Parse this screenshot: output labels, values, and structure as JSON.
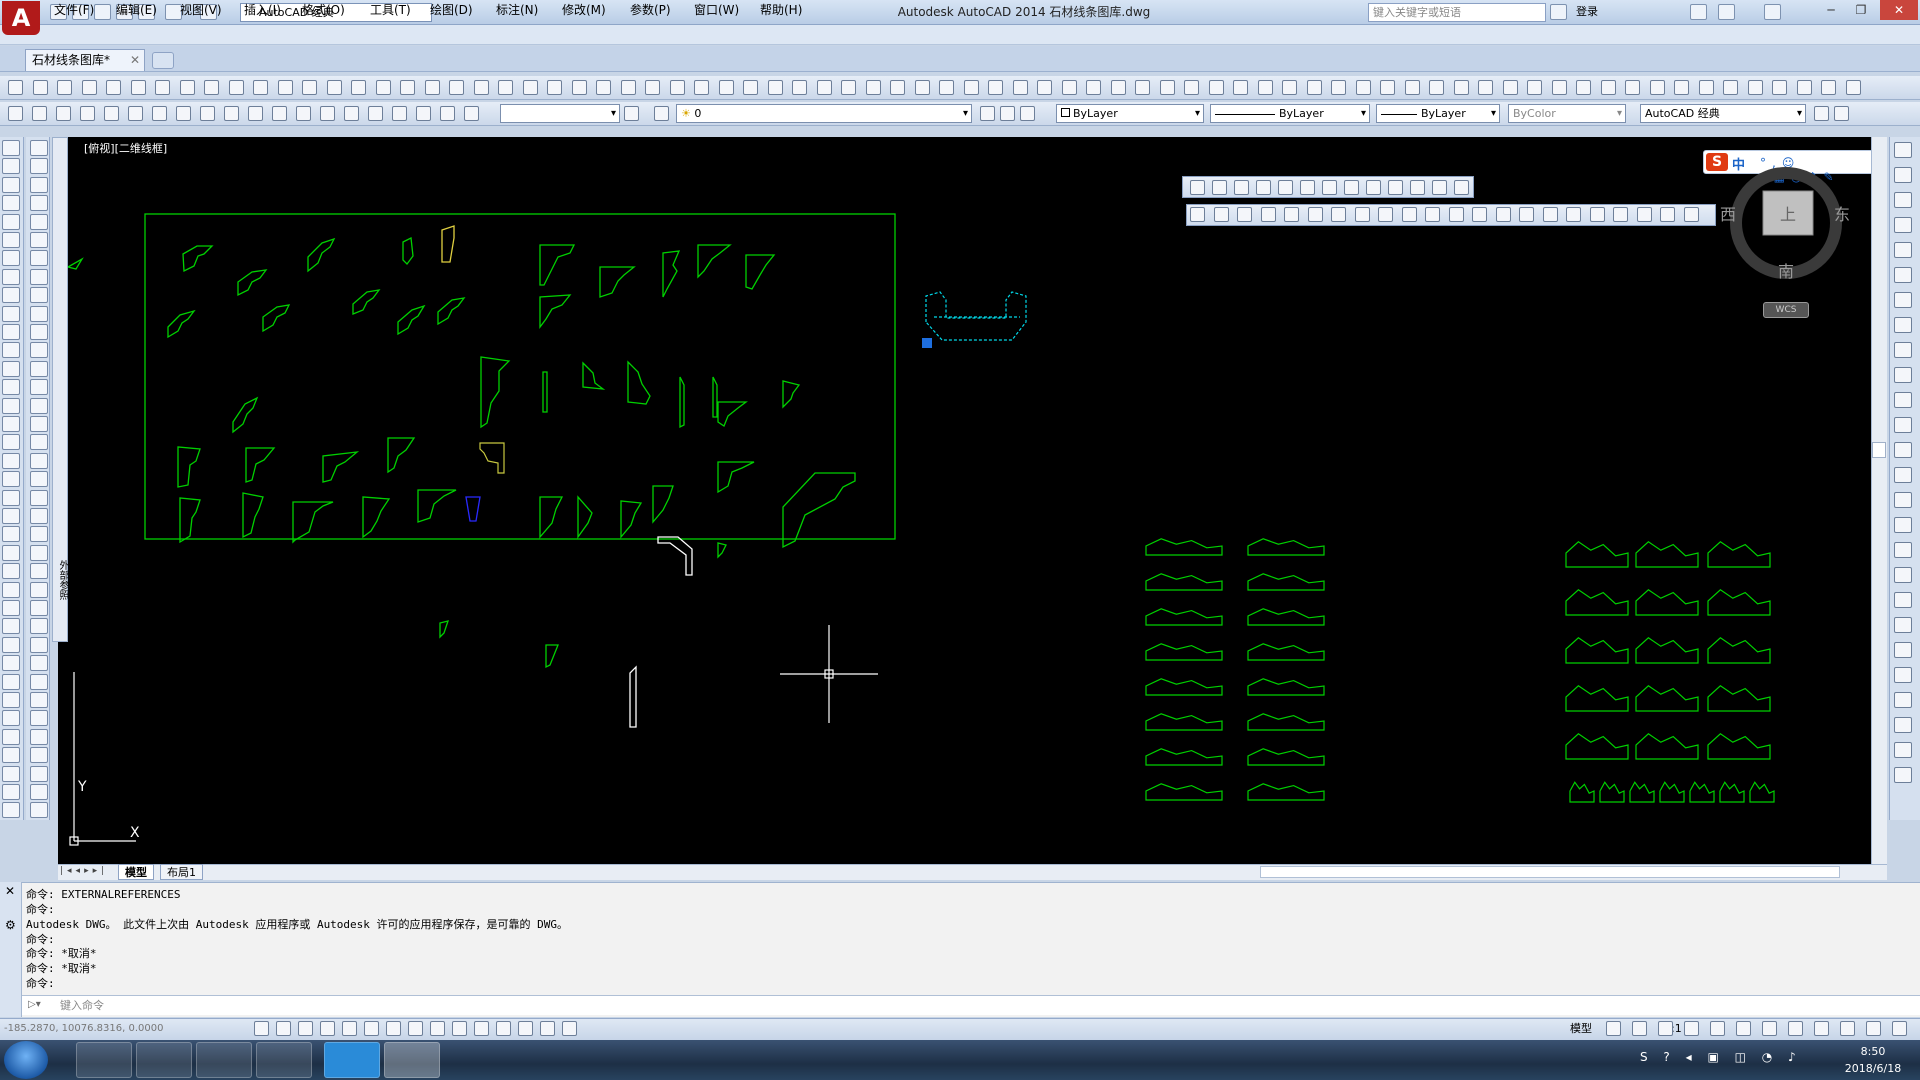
{
  "titlebar": {
    "workspace": "AutoCAD 经典",
    "title": "Autodesk AutoCAD 2014    石材线条图库.dwg",
    "search_placeholder": "键入关键字或短语",
    "login": "登录"
  },
  "menu": [
    "文件(F)",
    "编辑(E)",
    "视图(V)",
    "插入(I)",
    "格式(O)",
    "工具(T)",
    "绘图(D)",
    "标注(N)",
    "修改(M)",
    "参数(P)",
    "窗口(W)",
    "帮助(H)"
  ],
  "doc_tab": "石材线条图库*",
  "props": {
    "layer": "0",
    "color": "ByLayer",
    "linetype": "ByLayer",
    "lineweight": "ByLayer",
    "plotstyle": "ByColor",
    "workspace2": "AutoCAD 经典"
  },
  "viewport_label": "[俯视][二维线框]",
  "xref_panel": "外部参照",
  "navcube": {
    "west": "西",
    "east": "东",
    "south": "南",
    "face": "上",
    "wcs": "WCS"
  },
  "layout_tabs": [
    "模型",
    "布局1"
  ],
  "command_history": [
    "命令: EXTERNALREFERENCES",
    "命令:",
    "Autodesk DWG。  此文件上次由 Autodesk 应用程序或 Autodesk 许可的应用程序保存，是可靠的 DWG。",
    "命令:",
    "命令: *取消*",
    "命令: *取消*",
    "命令:"
  ],
  "command_placeholder": "键入命令",
  "status": {
    "coords": "-185.2870, 10076.8316, 0.0000",
    "model": "模型",
    "scale": "1:1"
  },
  "ime": {
    "logo": "S",
    "lang": "中"
  },
  "clock": {
    "time": "8:50",
    "date": "2018/6/18"
  },
  "colors": {
    "canvas": "#000000",
    "drawing": "#00d000",
    "crosshair": "#ffffff",
    "selection": "#00d8e8"
  }
}
